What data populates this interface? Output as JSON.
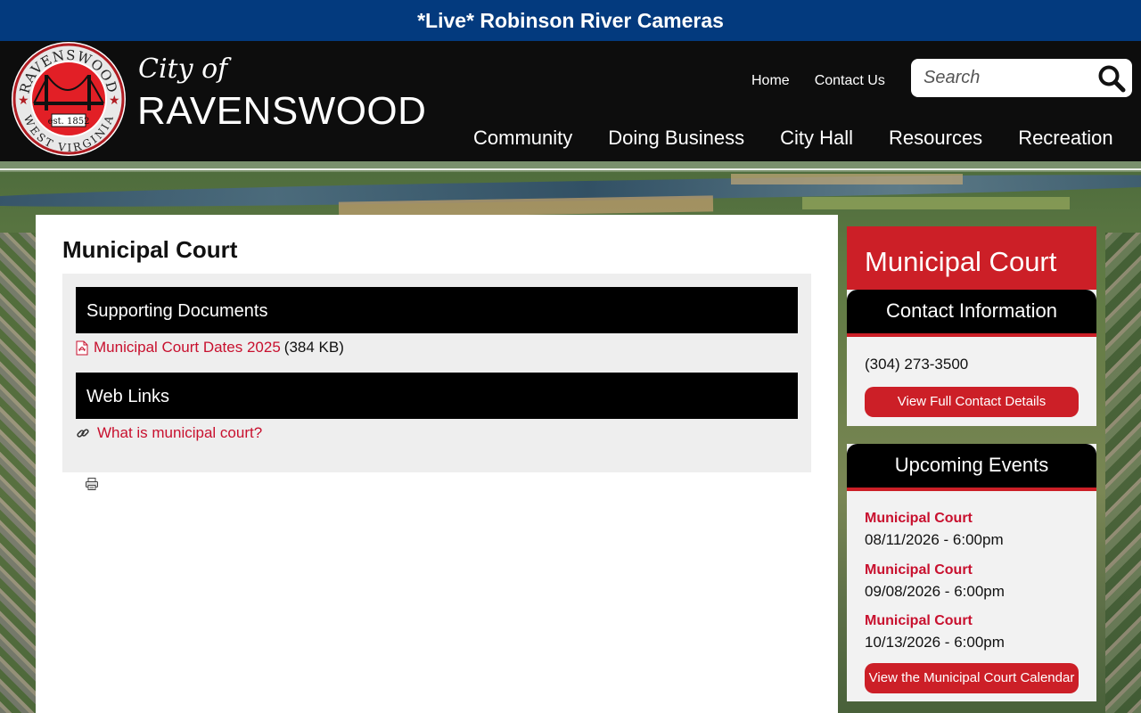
{
  "banner": {
    "text": "*Live* Robinson River Cameras"
  },
  "header": {
    "logo": {
      "top_text": "RAVENSWOOD",
      "bottom_text": "WEST VIRGINIA",
      "est": "est. 1852"
    },
    "city_of": "City of",
    "city_name": "RAVENSWOOD",
    "util_nav": [
      "Home",
      "Contact Us"
    ],
    "search": {
      "placeholder": "Search"
    },
    "main_nav": [
      "Community",
      "Doing Business",
      "City Hall",
      "Resources",
      "Recreation"
    ]
  },
  "main": {
    "title": "Municipal Court",
    "sections": {
      "supporting_documents": "Supporting Documents",
      "web_links": "Web Links"
    },
    "document": {
      "name": "Municipal Court Dates 2025",
      "size": "(384 KB)"
    },
    "web_link": "What is municipal court?"
  },
  "sidebar": {
    "title": "Municipal Court",
    "contact": {
      "heading": "Contact Information",
      "phone": "(304) 273-3500",
      "button": "View Full Contact Details"
    },
    "events": {
      "heading": "Upcoming Events",
      "items": [
        {
          "title": "Municipal Court",
          "date": "08/11/2026 - 6:00pm"
        },
        {
          "title": "Municipal Court",
          "date": "09/08/2026 - 6:00pm"
        },
        {
          "title": "Municipal Court",
          "date": "10/13/2026 - 6:00pm"
        }
      ],
      "button": "View the Municipal Court Calendar"
    }
  },
  "colors": {
    "banner_blue": "#033a7e",
    "accent_red": "#cc1f27",
    "link_red": "#c8102e",
    "header_black": "#0d0d0d"
  }
}
